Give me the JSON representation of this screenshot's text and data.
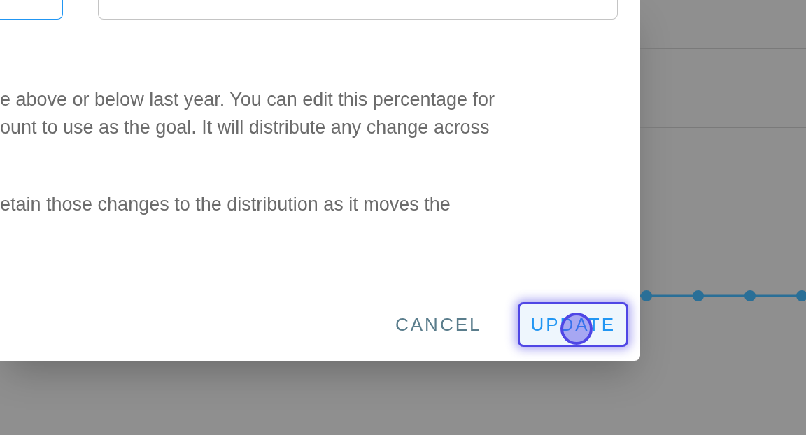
{
  "dialog": {
    "paragraphs": [
      [
        "e above or below last year. You can edit this percentage for",
        "ount to use as the goal. It will distribute any change across"
      ],
      [
        "etain those changes to the distribution as it moves the"
      ]
    ],
    "buttons": [
      {
        "label": "CANCEL",
        "kind": "text",
        "focused": false
      },
      {
        "label": "UPDATE",
        "kind": "primary",
        "focused": true
      }
    ]
  }
}
